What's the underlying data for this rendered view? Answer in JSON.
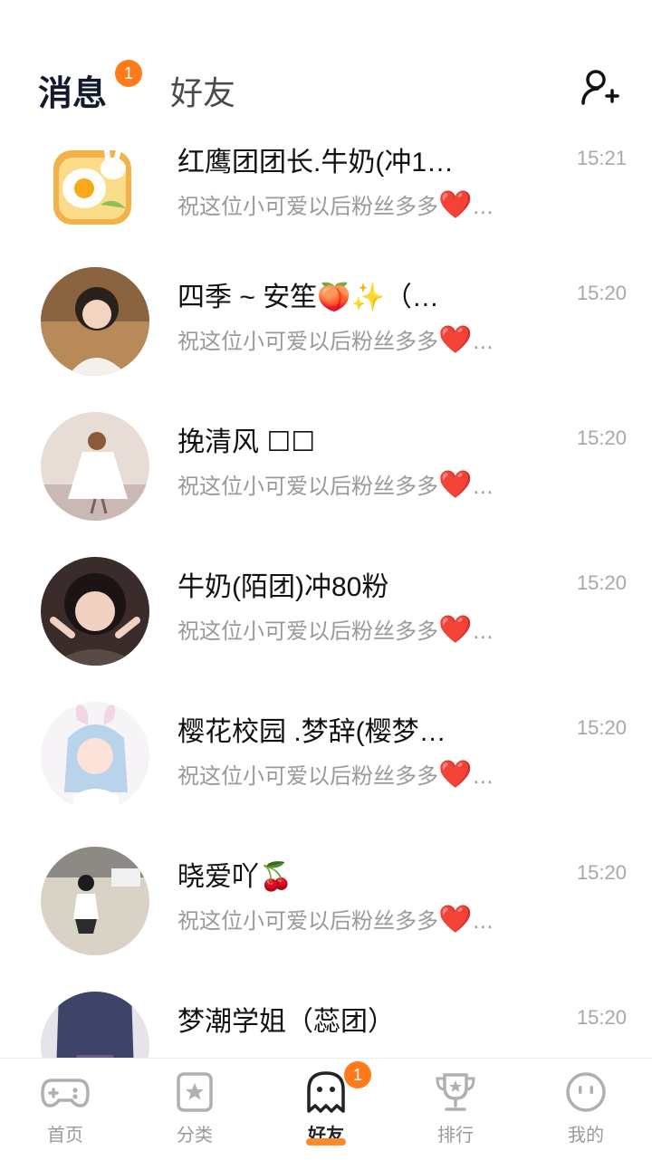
{
  "header": {
    "tab_messages": "消息",
    "tab_friends": "好友",
    "messages_badge": "1"
  },
  "conversations": [
    {
      "name": "红鹰团团长.牛奶(冲1…",
      "preview": "祝这位小可爱以后粉丝多多",
      "heart": "❤️",
      "ellipsis": "…",
      "time": "15:21"
    },
    {
      "name": "四季 ~ 安笙🍑✨（…",
      "preview": "祝这位小可爱以后粉丝多多",
      "heart": "❤️",
      "ellipsis": "…",
      "time": "15:20"
    },
    {
      "name": "挽清风 ☐☐",
      "preview": "祝这位小可爱以后粉丝多多",
      "heart": "❤️",
      "ellipsis": "…",
      "time": "15:20"
    },
    {
      "name": "牛奶(陌团)冲80粉",
      "preview": "祝这位小可爱以后粉丝多多",
      "heart": "❤️",
      "ellipsis": "…",
      "time": "15:20"
    },
    {
      "name": "樱花校园 .梦辞(樱梦…",
      "preview": "祝这位小可爱以后粉丝多多",
      "heart": "❤️",
      "ellipsis": "…",
      "time": "15:20"
    },
    {
      "name": "晓爱吖🍒",
      "preview": "祝这位小可爱以后粉丝多多",
      "heart": "❤️",
      "ellipsis": "…",
      "time": "15:20"
    },
    {
      "name": "梦潮学姐（蕊团）",
      "preview": "",
      "heart": "",
      "ellipsis": "",
      "time": "15:20"
    }
  ],
  "bottom_nav": {
    "items": [
      {
        "label": "首页",
        "icon": "gamepad-icon"
      },
      {
        "label": "分类",
        "icon": "category-icon"
      },
      {
        "label": "好友",
        "icon": "ghost-icon"
      },
      {
        "label": "排行",
        "icon": "trophy-icon"
      },
      {
        "label": "我的",
        "icon": "face-icon"
      }
    ],
    "friends_badge": "1",
    "active_index": 2
  },
  "colors": {
    "accent": "#ff7a1a",
    "title_text": "#141a2e",
    "secondary_text": "#9a9a9a"
  }
}
